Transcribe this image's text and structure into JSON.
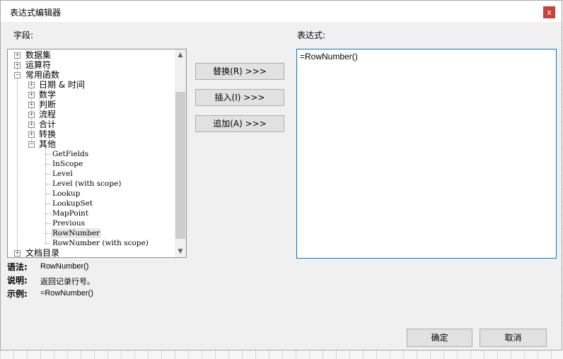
{
  "window": {
    "title": "表达式编辑器",
    "close": "x"
  },
  "labels": {
    "fields": "字段:",
    "expression": "表达式:"
  },
  "tree": {
    "nodes": [
      {
        "label": "数据集",
        "exp": "+"
      },
      {
        "label": "运算符",
        "exp": "+"
      },
      {
        "label": "常用函数",
        "exp": "−"
      },
      {
        "label": "日期 & 时间",
        "exp": "+"
      },
      {
        "label": "数学",
        "exp": "+"
      },
      {
        "label": "判断",
        "exp": "+"
      },
      {
        "label": "流程",
        "exp": "+"
      },
      {
        "label": "合计",
        "exp": "+"
      },
      {
        "label": "转换",
        "exp": "+"
      },
      {
        "label": "其他",
        "exp": "−"
      }
    ],
    "functions": [
      "GetFields",
      "InScope",
      "Level",
      "Level (with scope)",
      "Lookup",
      "LookupSet",
      "MapPoint",
      "Previous",
      "RowNumber",
      "RowNumber (with scope)"
    ],
    "last": {
      "label": "文档目录",
      "exp": "+"
    }
  },
  "buttons": {
    "replace": "替换(R) >>>",
    "insert": "插入(I) >>>",
    "append": "追加(A) >>>",
    "ok": "确定",
    "cancel": "取消"
  },
  "expression": "=RowNumber()",
  "info": {
    "syntax_label": "语法:",
    "syntax": "RowNumber()",
    "desc_label": "说明:",
    "desc": "返回记录行号。",
    "example_label": "示例:",
    "example": "=RowNumber()"
  }
}
